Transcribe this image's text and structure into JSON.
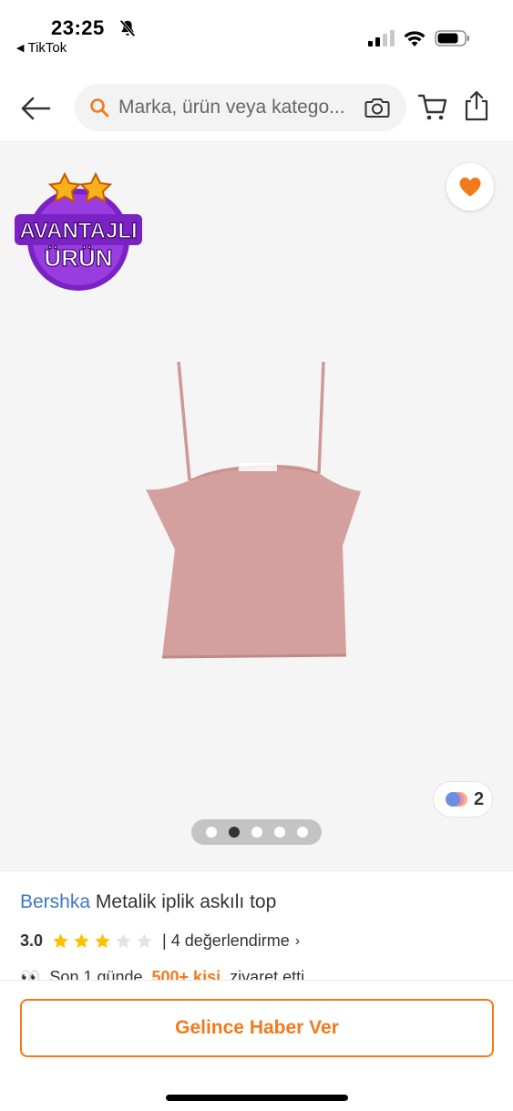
{
  "status_bar": {
    "time": "23:25",
    "back_app": "TikTok",
    "icons": [
      "bell-slash-icon",
      "cellular-signal-icon",
      "wifi-icon",
      "battery-icon"
    ]
  },
  "nav": {
    "search_placeholder": "Marka, ürün veya katego...",
    "icons": [
      "back-arrow-icon",
      "search-icon",
      "camera-icon",
      "cart-icon",
      "share-icon"
    ]
  },
  "gallery": {
    "badge_line1": "AVANTAJLI",
    "badge_line2": "ÜRÜN",
    "color_count": "2",
    "image_count": 5,
    "active_image": 1
  },
  "product": {
    "brand": "Bershka",
    "name": "Metalik iplik askılı top",
    "rating": "3.0",
    "rating_value": 3,
    "rating_max": 5,
    "review_text": "| 4 değerlendirme",
    "visit_prefix": "Son 1 günde",
    "visit_highlight": "500+ kişi",
    "visit_suffix": "ziyaret etti"
  },
  "cta": {
    "label": "Gelince Haber Ver"
  },
  "colors": {
    "accent": "#f27a1a",
    "brand_link": "#3b78c4",
    "product_pink": "#d4a09e",
    "badge_purple": "#8a2bd6"
  }
}
